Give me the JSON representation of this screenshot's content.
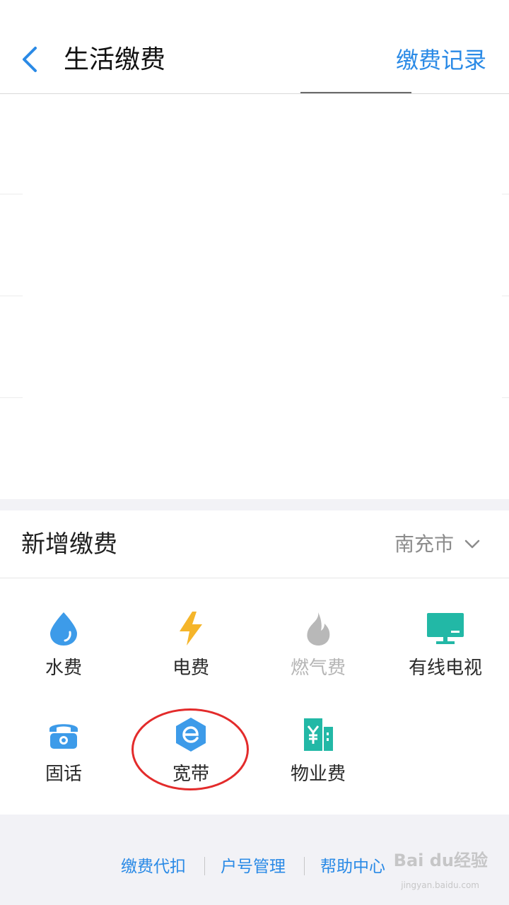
{
  "header": {
    "title": "生活缴费",
    "records_link": "缴费记录"
  },
  "new_payment": {
    "title": "新增缴费",
    "city": "南充市",
    "items": [
      {
        "label": "水费",
        "icon": "water-drop-icon",
        "color": "#3d9be9",
        "enabled": true
      },
      {
        "label": "电费",
        "icon": "lightning-icon",
        "color": "#f5b52a",
        "enabled": true
      },
      {
        "label": "燃气费",
        "icon": "flame-icon",
        "color": "#b8b8b8",
        "enabled": false
      },
      {
        "label": "有线电视",
        "icon": "tv-icon",
        "color": "#22b8a6",
        "enabled": true
      },
      {
        "label": "固话",
        "icon": "telephone-icon",
        "color": "#3d9be9",
        "enabled": true
      },
      {
        "label": "宽带",
        "icon": "broadband-icon",
        "color": "#3d9be9",
        "enabled": true
      },
      {
        "label": "物业费",
        "icon": "building-yuan-icon",
        "color": "#22b8a6",
        "enabled": true
      }
    ]
  },
  "footer": {
    "links": [
      "缴费代扣",
      "户号管理",
      "帮助中心"
    ]
  },
  "watermark": {
    "text": "Bai du经验",
    "url_text": "jingyan.baidu.com"
  },
  "colors": {
    "accent": "#2a8ae6",
    "highlight": "#e32b2b"
  }
}
